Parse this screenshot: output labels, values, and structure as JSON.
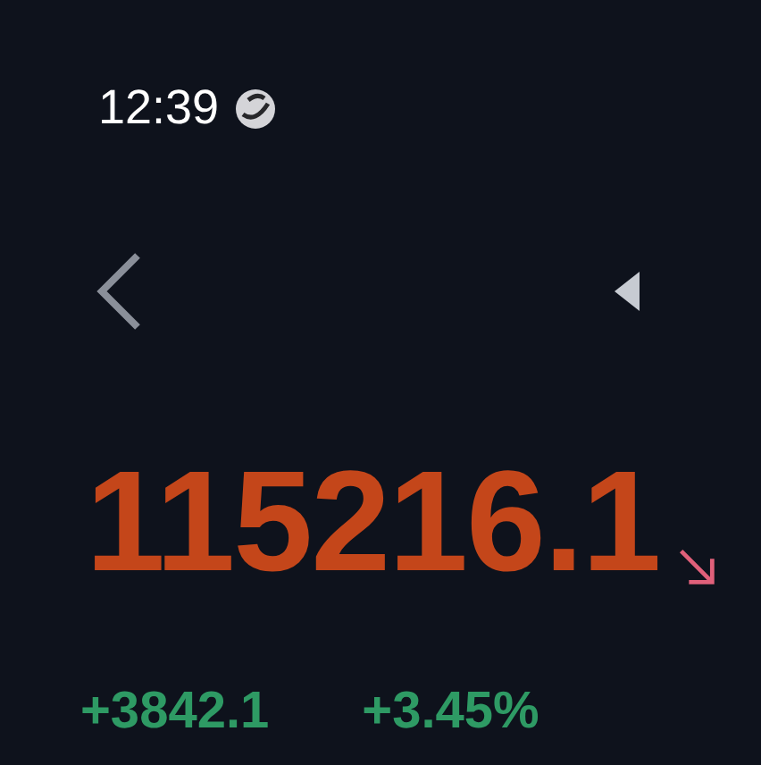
{
  "status_bar": {
    "time": "12:39"
  },
  "quote": {
    "price": "115216.1",
    "falling": true,
    "change": "+3842.1",
    "change_percent": "+3.45%"
  }
}
